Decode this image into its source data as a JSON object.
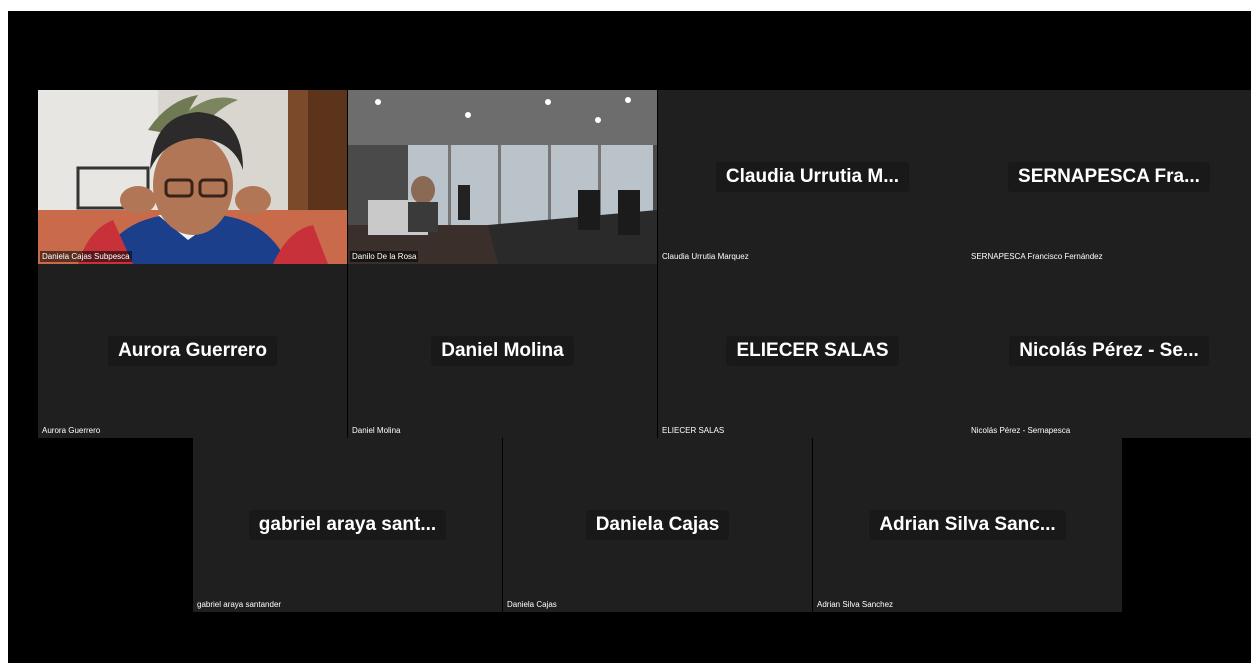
{
  "participants": {
    "video": [
      {
        "label": "Daniela Cajas Subpesca"
      },
      {
        "label": "Danilo De la Rosa"
      }
    ],
    "row1": [
      {
        "center": "Claudia Urrutia M...",
        "label": "Claudia Urrutia Marquez"
      },
      {
        "center": "SERNAPESCA Fra...",
        "label": "SERNAPESCA Francisco Fernández"
      }
    ],
    "row2": [
      {
        "center": "Aurora Guerrero",
        "label": "Aurora Guerrero"
      },
      {
        "center": "Daniel Molina",
        "label": "Daniel Molina"
      },
      {
        "center": "ELIECER SALAS",
        "label": "ELIECER SALAS"
      },
      {
        "center": "Nicolás Pérez - Se...",
        "label": "Nicolás Pérez - Sernapesca"
      }
    ],
    "row3": [
      {
        "center": "gabriel araya sant...",
        "label": "gabriel araya santander"
      },
      {
        "center": "Daniela Cajas",
        "label": "Daniela Cajas"
      },
      {
        "center": "Adrian Silva Sanc...",
        "label": "Adrian Silva Sanchez"
      }
    ]
  },
  "colors": {
    "background": "#000000",
    "tile": "#1f1f1f",
    "name_text": "#ffffff"
  }
}
